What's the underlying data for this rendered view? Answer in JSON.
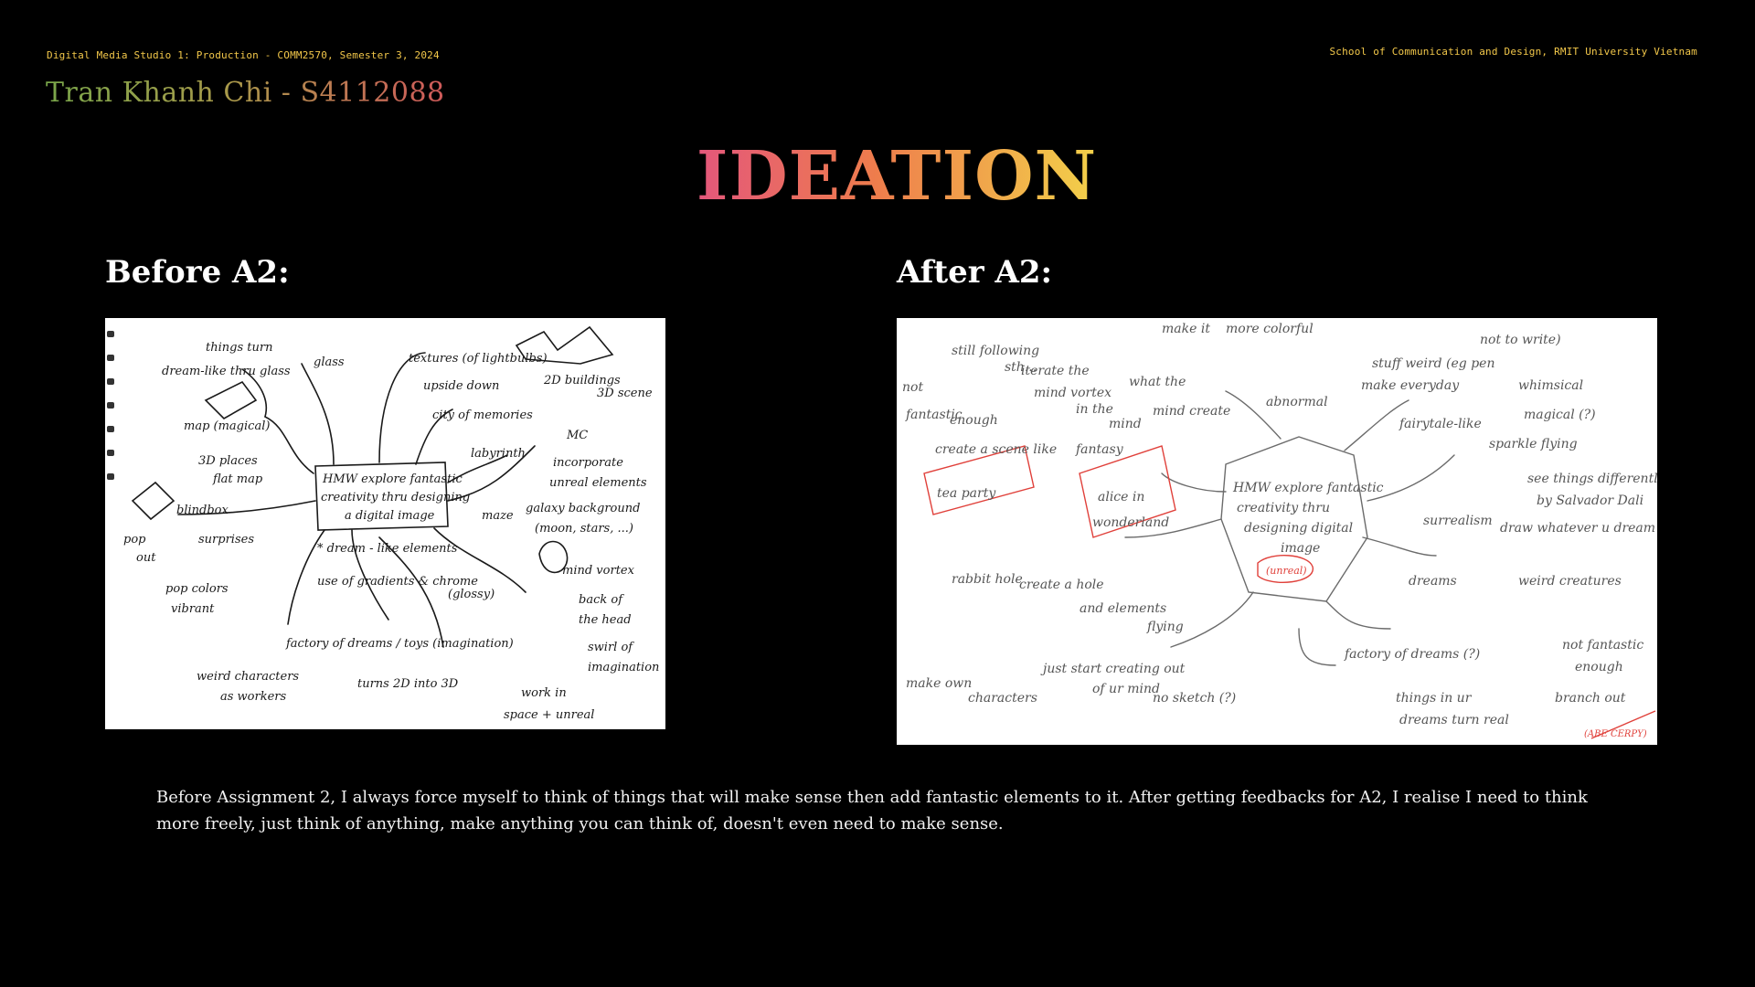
{
  "header": {
    "course": "Digital Media Studio 1: Production - COMM2570, Semester 3, 2024",
    "author": "Tran Khanh Chi - S4112088",
    "school": "School of Communication and Design, RMIT University Vietnam"
  },
  "title": "IDEATION",
  "sections": {
    "before_label": "Before A2:",
    "after_label": "After A2:"
  },
  "sketch_before": {
    "center_lines": [
      "HMW explore fantastic",
      "creativity thru designing",
      "a digital image"
    ],
    "notes": [
      "things turn",
      "dream-like thru glass",
      "glass",
      "textures (of lightbulbs)",
      "upside down",
      "city of memories",
      "2D buildings",
      "3D scene",
      "map (magical)",
      "3D places",
      "flat map",
      "labyrinth",
      "MC",
      "incorporate",
      "unreal elements",
      "blindbox",
      "surprises",
      "pop",
      "out",
      "maze",
      "galaxy background",
      "(moon, stars, ...)",
      "* dream - like elements",
      "pop colors",
      "vibrant",
      "use of gradients & chrome",
      "(glossy)",
      "mind vortex",
      "back of",
      "the head",
      "factory of dreams / toys (imagination)",
      "weird characters",
      "as workers",
      "turns 2D into 3D",
      "swirl of",
      "imagination",
      "work in",
      "space + unreal"
    ]
  },
  "sketch_after": {
    "center_lines": [
      "HMW explore fantastic",
      "creativity thru",
      "designing digital",
      "image"
    ],
    "center_note": "(unreal)",
    "notes": [
      "still following",
      "sth...",
      "make it",
      "more colorful",
      "not",
      "fantastic",
      "enough",
      "iterate the",
      "mind vortex",
      "what the",
      "mind create",
      "in the",
      "mind",
      "create a scene like",
      "abnormal",
      "make everyday",
      "stuff weird (eg pen",
      "not to write)",
      "fairytale-like",
      "whimsical",
      "magical (?)",
      "tea party",
      "fantasy",
      "alice in",
      "wonderland",
      "rabbit hole",
      "create a hole",
      "and elements",
      "flying",
      "sparkle flying",
      "surrealism",
      "see things differently",
      "by Salvador Dali",
      "draw whatever u dream",
      "dreams",
      "weird creatures",
      "make own",
      "characters",
      "just start creating out",
      "of ur mind",
      "no sketch (?)",
      "factory of dreams (?)",
      "not fantastic",
      "enough",
      "things in ur",
      "dreams turn real",
      "branch out",
      "(ABE CERPY)"
    ]
  },
  "caption": "Before Assignment 2, I always force myself to think of things that will make sense then add fantastic elements to it. After getting feedbacks for A2, I realise I need to think more freely, just think of anything, make anything you can think of, doesn't even need to make sense.",
  "colors": {
    "background": "#000000",
    "accent_yellow": "#f3c84a",
    "title_pink": "#e4577b",
    "title_orange": "#ee7d4c",
    "author_green": "#79a64a",
    "author_red": "#d05a5a",
    "sketch_ink": "#1a1a1a",
    "sketch_pencil": "#6b6b6b",
    "sketch_red_ink": "#e0403a"
  }
}
